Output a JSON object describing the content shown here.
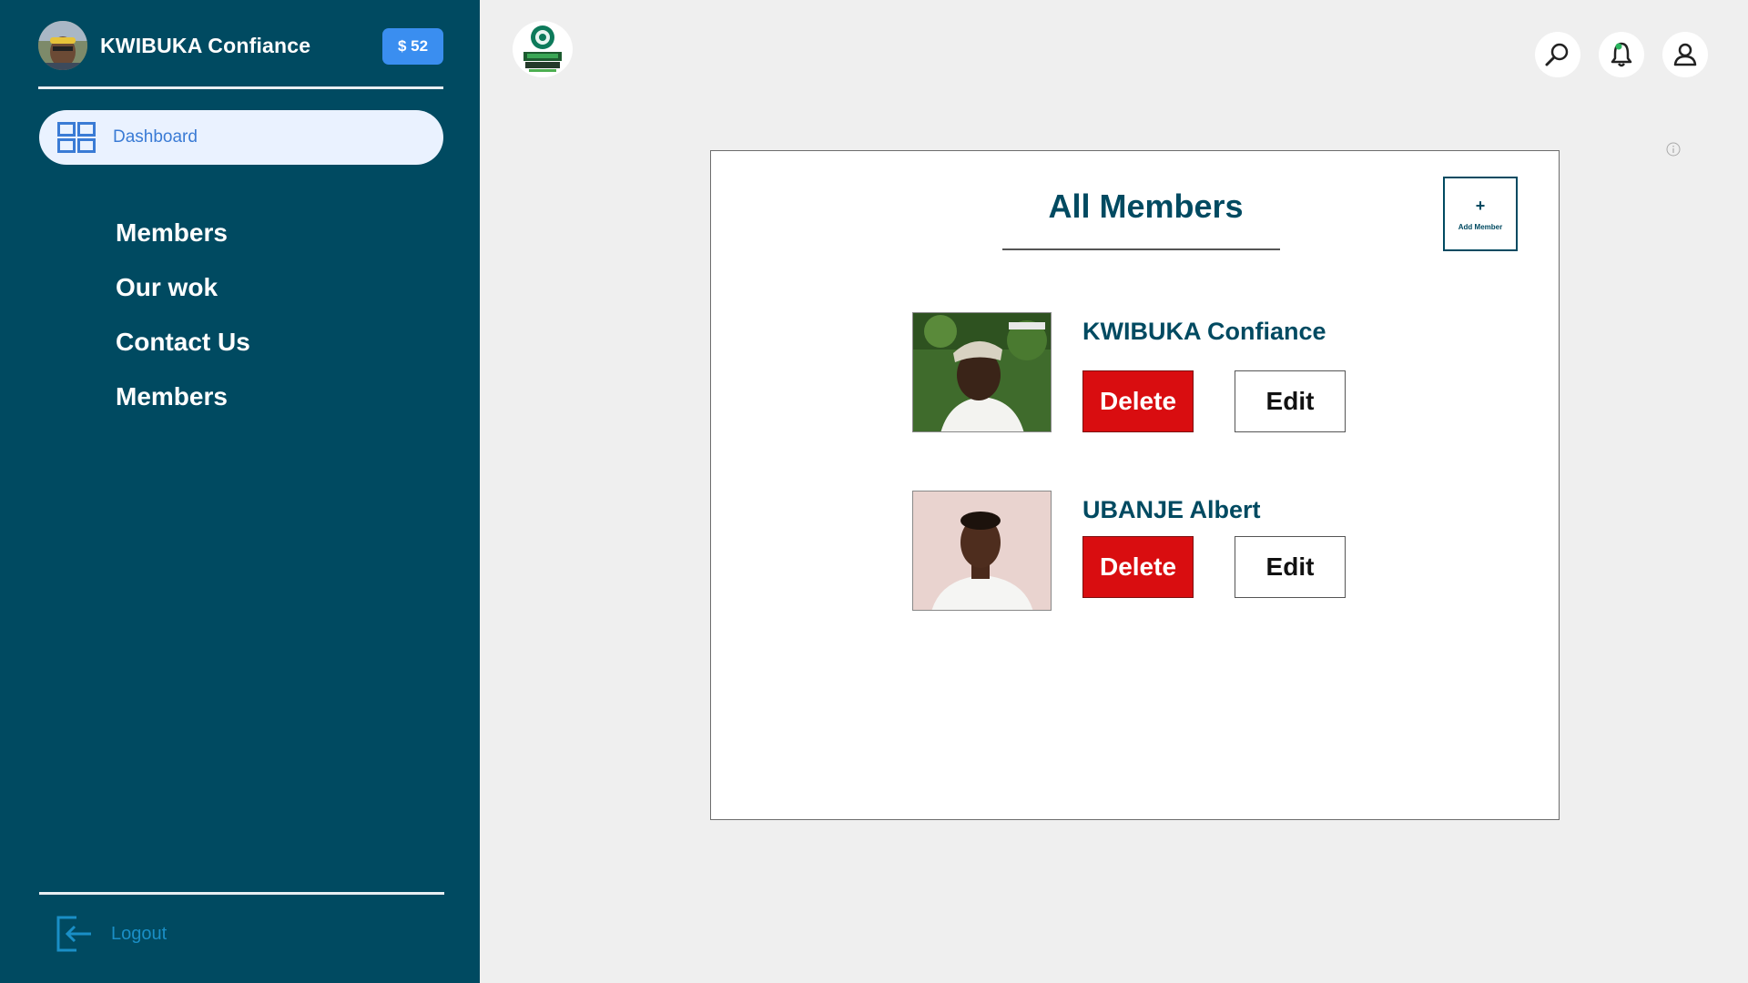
{
  "sidebar": {
    "user_name": "KWIBUKA Confiance",
    "balance": "$ 52",
    "dashboard_label": "Dashboard",
    "nav_items": [
      {
        "label": "Members"
      },
      {
        "label": "Our wok"
      },
      {
        "label": "Contact Us"
      },
      {
        "label": "Members"
      }
    ],
    "logout_label": "Logout"
  },
  "header": {
    "icons": [
      "search-icon",
      "bell-icon",
      "user-icon"
    ],
    "accent_color": "#004a61"
  },
  "main": {
    "title": "All Members",
    "add_button": {
      "symbol": "+",
      "label": "Add Member"
    },
    "members": [
      {
        "name": "KWIBUKA Confiance",
        "delete_label": "Delete",
        "edit_label": "Edit"
      },
      {
        "name": "UBANJE Albert",
        "delete_label": "Delete",
        "edit_label": "Edit"
      }
    ]
  },
  "colors": {
    "sidebar": "#004a61",
    "balance_badge": "#3a8ef0",
    "delete": "#d90d10",
    "title": "#004a61"
  }
}
